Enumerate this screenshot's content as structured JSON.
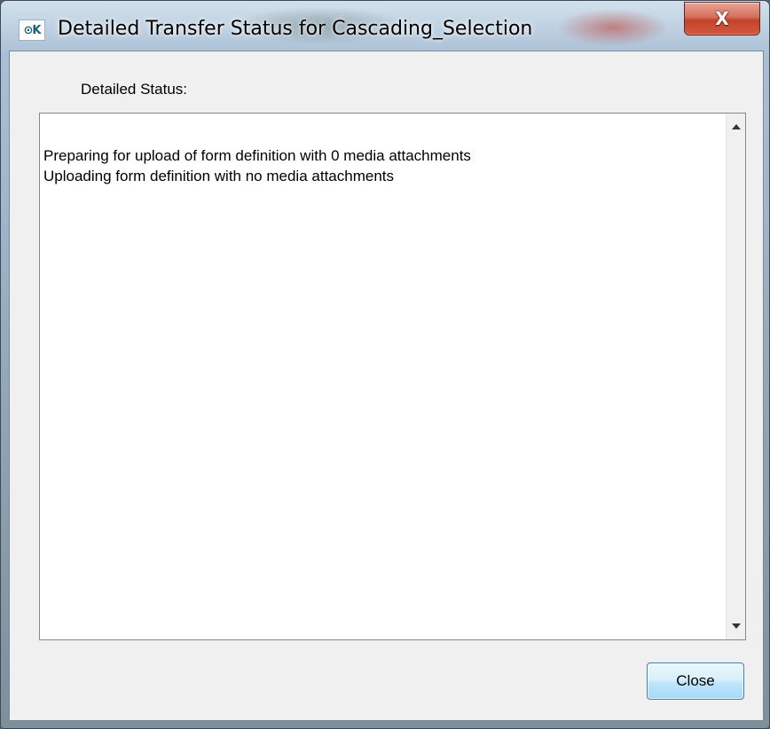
{
  "window": {
    "title": "Detailed Transfer Status for Cascading_Selection",
    "app_icon": "odk-app-icon",
    "close_glyph": "X"
  },
  "dialog": {
    "status_label": "Detailed Status:",
    "status_lines": [
      "Preparing for upload of form definition with 0 media attachments",
      "Uploading form definition with no media attachments"
    ],
    "close_button_label": "Close"
  },
  "icons": {
    "app": "odk-icon",
    "scroll_up": "scroll-up-arrow-icon",
    "scroll_down": "scroll-down-arrow-icon"
  },
  "colors": {
    "close_x_red": "#c2432b",
    "button_blue": "#bee6fd",
    "client_background": "#f0f0f0"
  }
}
